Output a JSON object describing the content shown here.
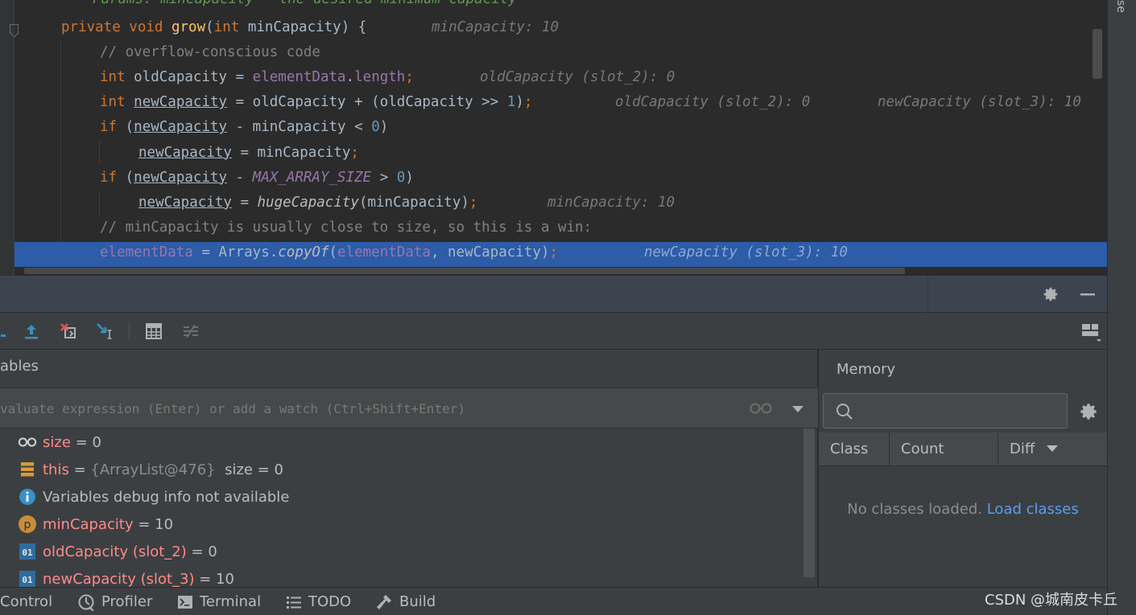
{
  "editor": {
    "doc_line": "* Params: minCapacity – the desired minimum capacity",
    "lines": [
      {
        "tokens": [
          [
            "kw",
            "private void "
          ],
          [
            "fn",
            "grow"
          ],
          [
            "plain",
            "("
          ],
          [
            "kw",
            "int "
          ],
          [
            "plain",
            "minCapacity) {"
          ]
        ],
        "hint": "minCapacity: 10"
      },
      {
        "tokens": [
          [
            "cmt",
            "// overflow-conscious code"
          ]
        ]
      },
      {
        "tokens": [
          [
            "kw",
            "int "
          ],
          [
            "plain",
            "oldCapacity = "
          ],
          [
            "field",
            "elementData"
          ],
          [
            "plain",
            "."
          ],
          [
            "field",
            "length"
          ],
          [
            "kw",
            ";"
          ]
        ],
        "hint": "oldCapacity (slot_2): 0"
      },
      {
        "tokens": [
          [
            "kw",
            "int "
          ],
          [
            "plainul",
            "newCapacity"
          ],
          [
            "plain",
            " = oldCapacity + (oldCapacity >> "
          ],
          [
            "num",
            "1"
          ],
          [
            "plain",
            ")"
          ],
          [
            "kw",
            ";"
          ]
        ],
        "hint": "oldCapacity (slot_2): 0",
        "hint2": "newCapacity (slot_3): 10"
      },
      {
        "tokens": [
          [
            "kw",
            "if "
          ],
          [
            "plain",
            "("
          ],
          [
            "plainul",
            "newCapacity"
          ],
          [
            "plain",
            " - minCapacity < "
          ],
          [
            "num",
            "0"
          ],
          [
            "plain",
            ")"
          ]
        ]
      },
      {
        "tokens": [
          [
            "plainul",
            "newCapacity"
          ],
          [
            "plain",
            " = minCapacity"
          ],
          [
            "kw",
            ";"
          ]
        ]
      },
      {
        "tokens": [
          [
            "kw",
            "if "
          ],
          [
            "plain",
            "("
          ],
          [
            "plainul",
            "newCapacity"
          ],
          [
            "plain",
            " - "
          ],
          [
            "static",
            "MAX_ARRAY_SIZE"
          ],
          [
            "plain",
            " > "
          ],
          [
            "num",
            "0"
          ],
          [
            "plain",
            ")"
          ]
        ]
      },
      {
        "tokens": [
          [
            "plainul",
            "newCapacity"
          ],
          [
            "plain",
            " = "
          ],
          [
            "italic",
            "hugeCapacity"
          ],
          [
            "plain",
            "(minCapacity)"
          ],
          [
            "kw",
            ";"
          ]
        ],
        "hint": "minCapacity: 10"
      },
      {
        "tokens": [
          [
            "cmt",
            "// minCapacity is usually close to size, so this is a win:"
          ]
        ]
      },
      {
        "tokens": [
          [
            "field",
            "elementData"
          ],
          [
            "plain",
            " = Arrays."
          ],
          [
            "italic",
            "copyOf"
          ],
          [
            "plain",
            "("
          ],
          [
            "field",
            "elementData"
          ],
          [
            "plain",
            ", newCapacity)"
          ],
          [
            "kw",
            ";"
          ]
        ],
        "hint": "newCapacity (slot_3): 10"
      }
    ]
  },
  "side_strip": {
    "label": "se"
  },
  "variables": {
    "title": "ables",
    "eval_placeholder": "valuate expression (Enter) or add a watch (Ctrl+Shift+Enter)",
    "items": [
      {
        "icon": "watch-glasses-icon",
        "name": "size",
        "eq": " = ",
        "value": "0"
      },
      {
        "icon": "object-stack-icon",
        "name": "this",
        "eq": " = ",
        "ref": "{ArrayList@476}",
        "value": "size = 0"
      },
      {
        "icon": "info-icon",
        "info": "Variables debug info not available"
      },
      {
        "icon": "parameter-icon",
        "name": "minCapacity",
        "eq": " = ",
        "value": "10"
      },
      {
        "icon": "primitive-icon",
        "name": "oldCapacity (slot_2)",
        "eq": " = ",
        "value": "0"
      },
      {
        "icon": "primitive-icon",
        "name": "newCapacity (slot_3)",
        "eq": " = ",
        "value": "10"
      }
    ]
  },
  "memory": {
    "title": "Memory",
    "search_placeholder": "",
    "columns": [
      "Class",
      "Count",
      "Diff"
    ],
    "empty_text": "No classes loaded.",
    "load_link": "Load classes"
  },
  "statusbar": {
    "items": [
      {
        "icon": "",
        "label": "Control"
      },
      {
        "icon": "profiler-icon",
        "label": "Profiler"
      },
      {
        "icon": "terminal-icon",
        "label": "Terminal"
      },
      {
        "icon": "todo-icon",
        "label": "TODO"
      },
      {
        "icon": "build-icon",
        "label": "Build"
      }
    ],
    "watermark": "CSDN @城南皮卡丘"
  },
  "colors": {
    "keyword": "#cc7832",
    "function": "#ffc66d",
    "field": "#9876aa",
    "number": "#6897bb",
    "comment": "#808080",
    "plain": "#a9b7c6",
    "selection": "#2d5ca8",
    "var_name": "#ff8a8a",
    "link": "#589df6"
  }
}
